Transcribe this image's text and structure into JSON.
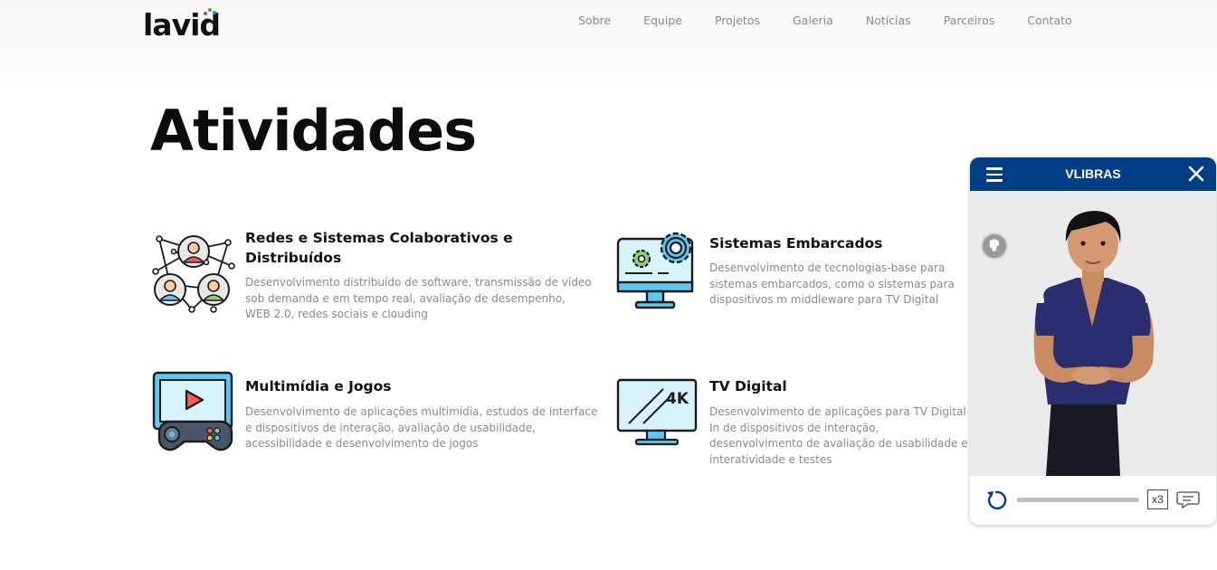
{
  "header": {
    "logo_text": "lavid",
    "nav": [
      {
        "label": "Sobre"
      },
      {
        "label": "Equipe"
      },
      {
        "label": "Projetos"
      },
      {
        "label": "Galeria"
      },
      {
        "label": "Notícias"
      },
      {
        "label": "Parceiros"
      },
      {
        "label": "Contato"
      }
    ]
  },
  "page": {
    "title": "Atividades"
  },
  "activities": [
    {
      "title": "Redes e Sistemas Colaborativos e Distribuídos",
      "description": "Desenvolvimento distribuído de software, transmissão de vídeo sob demanda e em tempo real, avaliação de desempenho, WEB 2.0, redes sociais e clouding",
      "icon": "network-people-icon"
    },
    {
      "title": "Sistemas Embarcados",
      "description": "Desenvolvimento de tecnologias-base para sistemas embarcados, como o sistemas para dispositivos m middleware para TV Digital",
      "icon": "monitor-gears-icon"
    },
    {
      "title": "Multimídia e Jogos",
      "description": "Desenvolvimento de aplicações multimídia, estudos de interface e dispositivos de interação, avaliação de usabilidade, acessibilidade e desenvolvimento de jogos",
      "icon": "video-gamepad-icon"
    },
    {
      "title": "TV Digital",
      "description": "Desenvolvimento de aplicações para TV Digital In de dispositivos de interação, desenvolvimento de avaliação de usabilidade e interatividade e testes",
      "icon": "tv-4k-icon"
    }
  ],
  "vlibras": {
    "title": "VLIBRAS",
    "speed_label": "x3",
    "progress": 0
  },
  "colors": {
    "vlibras_header": "#003f86",
    "nav_text": "#8a8a8a",
    "description_text": "#8a8a8a"
  }
}
